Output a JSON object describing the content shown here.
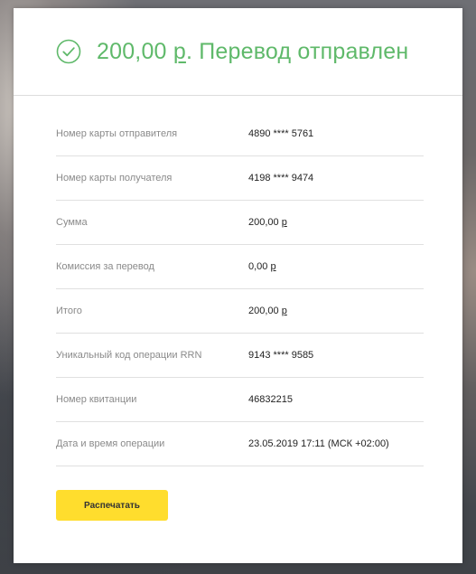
{
  "header": {
    "amount": "200,00",
    "currency": "р",
    "status": ". Перевод отправлен"
  },
  "details": [
    {
      "label": "Номер карты отправителя",
      "value": "4890 **** 5761",
      "currency": ""
    },
    {
      "label": "Номер карты получателя",
      "value": "4198 **** 9474",
      "currency": ""
    },
    {
      "label": "Сумма",
      "value": "200,00 ",
      "currency": "р"
    },
    {
      "label": "Комиссия за перевод",
      "value": "0,00 ",
      "currency": "р"
    },
    {
      "label": "Итого",
      "value": "200,00 ",
      "currency": "р"
    },
    {
      "label": "Уникальный код операции RRN",
      "value": "9143 **** 9585",
      "currency": ""
    },
    {
      "label": "Номер квитанции",
      "value": "46832215",
      "currency": ""
    },
    {
      "label": "Дата и время операции",
      "value": "23.05.2019 17:11 (МСК +02:00)",
      "currency": ""
    }
  ],
  "actions": {
    "print_label": "Распечатать"
  },
  "colors": {
    "accent_green": "#5fb96a",
    "button_yellow": "#ffdd2d"
  },
  "icons": {
    "status": "check-circle-icon"
  }
}
